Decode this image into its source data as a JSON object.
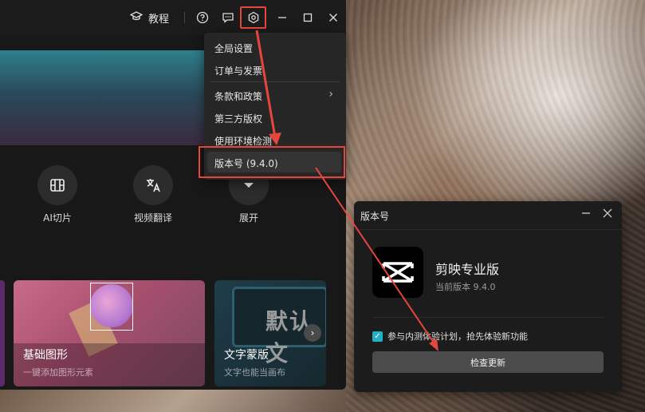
{
  "titlebar": {
    "tutorial_label": "教程",
    "icons": [
      "graduation-cap-icon",
      "help-icon",
      "feedback-icon",
      "settings-icon",
      "minimize-icon",
      "maximize-icon",
      "close-icon"
    ]
  },
  "tools": [
    {
      "label": "AI切片",
      "icon": "film-slice-icon"
    },
    {
      "label": "视频翻译",
      "icon": "translate-icon"
    },
    {
      "label": "展开",
      "icon": "chevron-down-icon"
    }
  ],
  "cards": [
    {
      "title": "基础图形",
      "subtitle": "一键添加图形元素"
    },
    {
      "title": "文字蒙版",
      "subtitle": "文字也能当画布",
      "deco_text": "默认文"
    }
  ],
  "menu": {
    "items": [
      "全局设置",
      "订单与发票",
      "条款和政策",
      "第三方版权",
      "使用环境检测",
      "版本号 (9.4.0)"
    ]
  },
  "dialog": {
    "title": "版本号",
    "app_name": "剪映专业版",
    "current_version": "当前版本 9.4.0",
    "beta_label": "参与内测体验计划，抢先体验新功能",
    "beta_checked": true,
    "update_button": "检查更新"
  },
  "colors": {
    "highlight_red": "#e8463c",
    "checkbox_accent": "#21b0c6"
  }
}
